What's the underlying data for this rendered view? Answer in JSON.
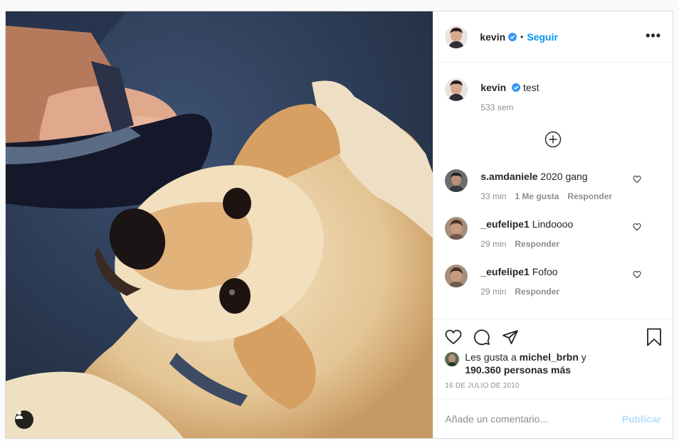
{
  "header": {
    "username": "kevin",
    "verified_icon": "verified-badge-icon",
    "separator": "•",
    "follow_label": "Seguir",
    "more_label": "•••"
  },
  "caption": {
    "username": "kevin",
    "text": "test",
    "time": "533 sem"
  },
  "comments": [
    {
      "username": "s.amdaniele",
      "text": "2020 gang",
      "time": "33 min",
      "likes": "1 Me gusta",
      "reply": "Responder"
    },
    {
      "username": "_eufelipe1",
      "text": "Lindoooo",
      "time": "29 min",
      "reply": "Responder"
    },
    {
      "username": "_eufelipe1",
      "text": "Fofoo",
      "time": "29 min",
      "reply": "Responder"
    }
  ],
  "likes": {
    "prefix": "Les gusta a",
    "user": "michel_brbn",
    "joiner": "y",
    "count": "190.360 personas más"
  },
  "date": "16 DE JULIO DE 2010",
  "compose": {
    "placeholder": "Añade un comentario...",
    "publish_label": "Publicar"
  },
  "colors": {
    "accent": "#0095f6",
    "publish_disabled": "#b2dffc",
    "muted": "#8e8e8e"
  }
}
